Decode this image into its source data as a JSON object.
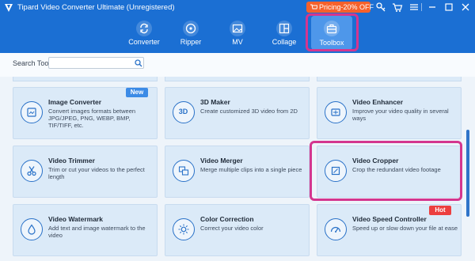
{
  "app": {
    "title": "Tipard Video Converter Ultimate (Unregistered)"
  },
  "header": {
    "pricing_label": "Pricing-20% OFF",
    "window_icons": [
      "key-icon",
      "cart-icon",
      "menu-icon",
      "minimize-icon",
      "maximize-icon",
      "close-icon"
    ]
  },
  "nav": {
    "converter": "Converter",
    "ripper": "Ripper",
    "mv": "MV",
    "collage": "Collage",
    "toolbox": "Toolbox"
  },
  "search": {
    "label": "Search Tool:",
    "value": ""
  },
  "cards": {
    "image_converter": {
      "title": "Image Converter",
      "desc": "Convert images formats between JPG/JPEG, PNG, WEBP, BMP, TIF/TIFF, etc."
    },
    "three_d_maker": {
      "title": "3D Maker",
      "desc": "Create customized 3D video from 2D",
      "icon_text": "3D"
    },
    "video_enhancer": {
      "title": "Video Enhancer",
      "desc": "Improve your video quality in several ways"
    },
    "video_trimmer": {
      "title": "Video Trimmer",
      "desc": "Trim or cut your videos to the perfect length"
    },
    "video_merger": {
      "title": "Video Merger",
      "desc": "Merge multiple clips into a single piece"
    },
    "video_cropper": {
      "title": "Video Cropper",
      "desc": "Crop the redundant video footage"
    },
    "video_watermark": {
      "title": "Video Watermark",
      "desc": "Add text and image watermark to the video"
    },
    "color_correction": {
      "title": "Color Correction",
      "desc": "Correct your video color"
    },
    "video_speed_controller": {
      "title": "Video Speed Controller",
      "desc": "Speed up or slow down your file at ease"
    }
  },
  "badges": {
    "new": "New",
    "hot": "Hot"
  },
  "colors": {
    "header_bg": "#1b6fd3",
    "highlight": "#d4368f",
    "card_bg": "#dbeaf8",
    "badge_new": "#3c8be6",
    "badge_hot": "#ec3f3f",
    "pricing_bg": "#f6612b"
  }
}
